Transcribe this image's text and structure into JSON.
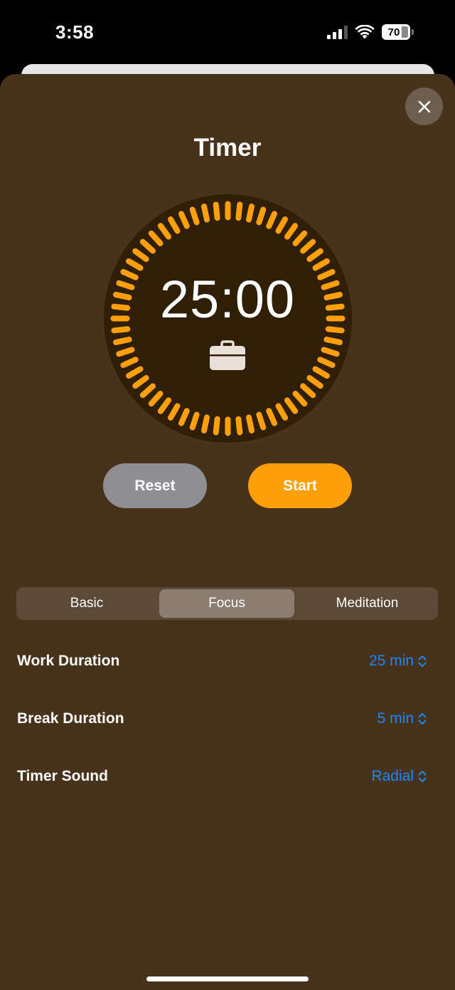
{
  "status_bar": {
    "time": "3:58",
    "battery": "70",
    "signal_icon": "cellular-signal-icon",
    "wifi_icon": "wifi-icon"
  },
  "header": {
    "title": "Timer",
    "close_icon": "close-icon"
  },
  "timer": {
    "display": "25:00",
    "mode_icon": "briefcase-icon",
    "progress": 1.0,
    "accent": "#ff9f0a"
  },
  "buttons": {
    "reset": "Reset",
    "start": "Start"
  },
  "modes": {
    "items": [
      "Basic",
      "Focus",
      "Meditation"
    ],
    "selected": "Focus"
  },
  "settings": [
    {
      "label": "Work Duration",
      "value": "25 min"
    },
    {
      "label": "Break Duration",
      "value": "5 min"
    },
    {
      "label": "Timer Sound",
      "value": "Radial"
    }
  ],
  "colors": {
    "sheet_bg": "#47331b",
    "link": "#1f87f5",
    "reset_bg": "#8e8e93",
    "start_bg": "#ff9f0a"
  }
}
